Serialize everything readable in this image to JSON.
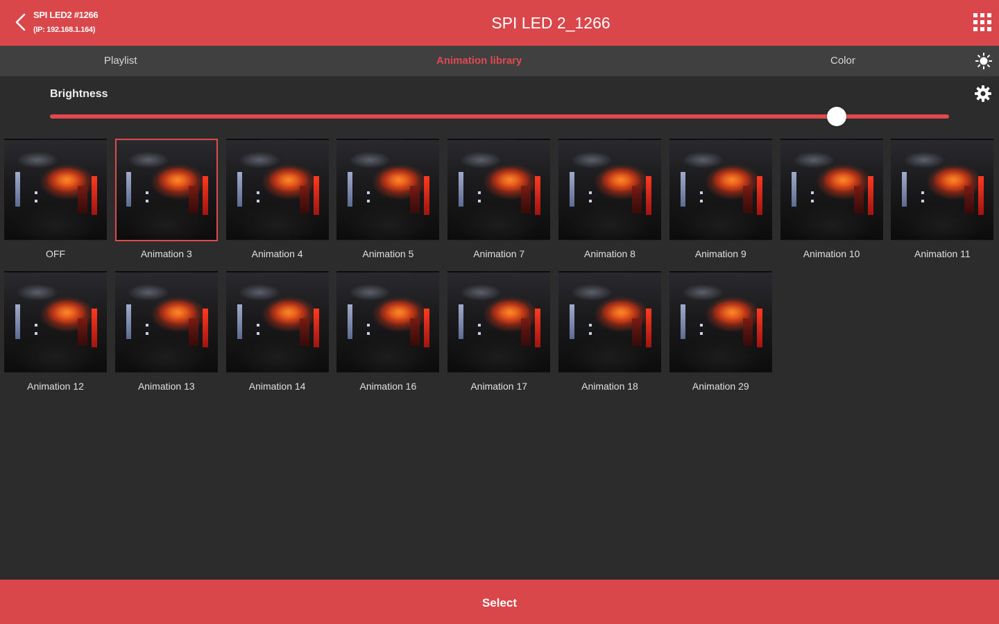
{
  "header": {
    "back_icon": "chevron-left-icon",
    "device_name": "SPI LED2 #1266",
    "device_ip": "(IP: 192.168.1.164)",
    "title": "SPI LED 2_1266",
    "menu_icon": "grid-icon",
    "color": "#d9474b"
  },
  "tabs": {
    "items": [
      {
        "label": "Playlist",
        "active": false
      },
      {
        "label": "Animation library",
        "active": true
      },
      {
        "label": "Color",
        "active": false
      }
    ],
    "sun_icon": "sun-icon",
    "active_color": "#e04a4e"
  },
  "brightness": {
    "label": "Brightness",
    "settings_icon": "gear-icon",
    "value_fraction": 0.875
  },
  "animations": [
    {
      "label": "OFF",
      "selected": false
    },
    {
      "label": "Animation 3",
      "selected": true
    },
    {
      "label": "Animation 4",
      "selected": false
    },
    {
      "label": "Animation 5",
      "selected": false
    },
    {
      "label": "Animation 7",
      "selected": false
    },
    {
      "label": "Animation 8",
      "selected": false
    },
    {
      "label": "Animation 9",
      "selected": false
    },
    {
      "label": "Animation 10",
      "selected": false
    },
    {
      "label": "Animation 11",
      "selected": false
    },
    {
      "label": "Animation 12",
      "selected": false
    },
    {
      "label": "Animation 13",
      "selected": false
    },
    {
      "label": "Animation 14",
      "selected": false
    },
    {
      "label": "Animation 16",
      "selected": false
    },
    {
      "label": "Animation 17",
      "selected": false
    },
    {
      "label": "Animation 18",
      "selected": false
    },
    {
      "label": "Animation 29",
      "selected": false
    }
  ],
  "footer": {
    "select_label": "Select"
  }
}
